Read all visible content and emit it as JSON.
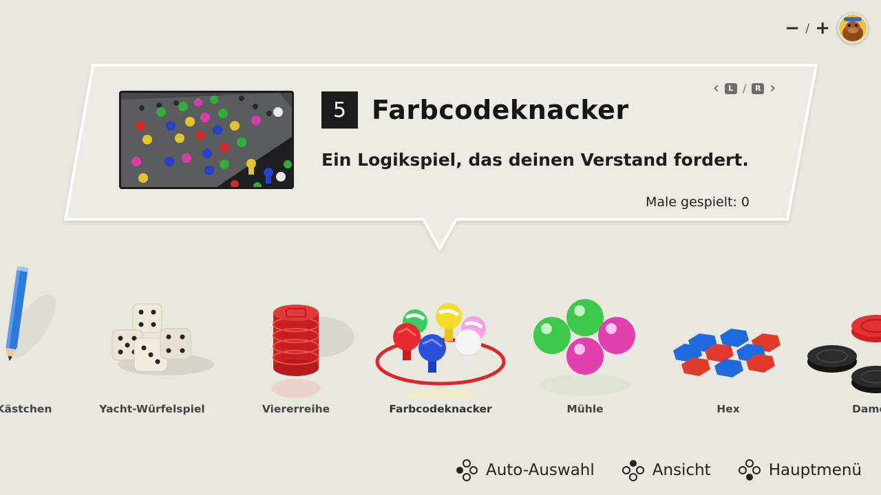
{
  "top": {
    "zoom_minus": "−",
    "zoom_separator": "/",
    "zoom_plus": "+"
  },
  "panel": {
    "game_number": "5",
    "game_title": "Farbcodeknacker",
    "description": "Ein Logikspiel, das deinen Verstand fordert.",
    "played_label": "Male gespielt:",
    "played_count": "0",
    "nav_left_key": "L",
    "nav_separator": "/",
    "nav_right_key": "R"
  },
  "carousel": {
    "items": [
      {
        "label": "Kästchen",
        "icon": "pencil-icon"
      },
      {
        "label": "Yacht-Würfelspiel",
        "icon": "dice-icon"
      },
      {
        "label": "Viererreihe",
        "icon": "stacked-chips-icon"
      },
      {
        "label": "Farbcodeknacker",
        "icon": "code-pegs-icon",
        "selected": true
      },
      {
        "label": "Mühle",
        "icon": "marbles-icon"
      },
      {
        "label": "Hex",
        "icon": "hex-tiles-icon"
      },
      {
        "label": "Dame",
        "icon": "checkers-icon"
      }
    ]
  },
  "hints": [
    {
      "label": "Auto-Auswahl",
      "icon": "button-cluster-icon"
    },
    {
      "label": "Ansicht",
      "icon": "button-cluster-icon"
    },
    {
      "label": "Hauptmenü",
      "icon": "button-cluster-icon"
    }
  ],
  "colors": {
    "background": "#e9e8df",
    "panel": "#ecebe3",
    "accent_red": "#e0252a",
    "title_box": "#1b1b1b"
  }
}
